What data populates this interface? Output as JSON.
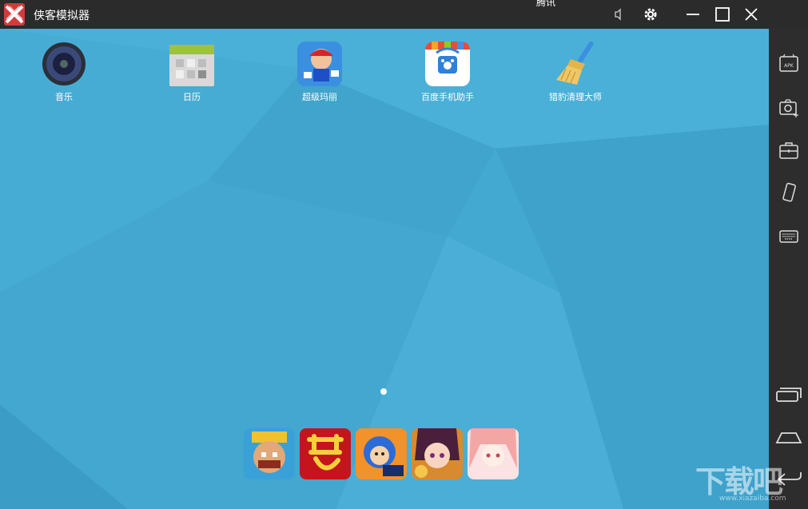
{
  "titlebar": {
    "app_title": "侠客模拟器",
    "center_title": "腾讯"
  },
  "desktop": {
    "apps": [
      {
        "label": "音乐"
      },
      {
        "label": "日历"
      },
      {
        "label": "超级玛丽"
      },
      {
        "label": "百度手机助手"
      },
      {
        "label": "猎豹清理大师"
      }
    ],
    "page_indicator": {
      "current": 1,
      "total": 1
    }
  },
  "dock": {
    "items": [
      "clash-royale",
      "menghuan",
      "cartoon-game",
      "girl-game",
      "anime-game"
    ]
  },
  "watermark": {
    "text": "下载吧",
    "site": "www.xiazaiba.com"
  },
  "colors": {
    "titlebar": "#2b2b2b",
    "wallpaper": "#44a9d1",
    "sidebar": "#2d2d2d"
  }
}
